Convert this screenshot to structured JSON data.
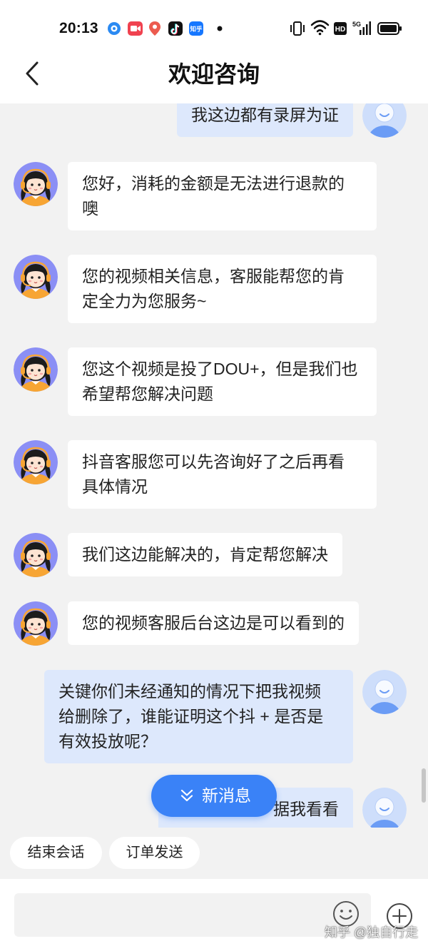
{
  "status_bar": {
    "time": "20:13",
    "notification_icons": [
      "app-circle-icon",
      "video-recorder-icon",
      "map-pin-icon",
      "tiktok-icon",
      "zhihu-icon",
      "more-dot-icon"
    ],
    "zhihu_icon_label": "知乎",
    "system_icons": [
      "vibrate-icon",
      "wifi-icon",
      "hd-icon",
      "signal-icon",
      "battery-icon"
    ],
    "hd_label": "HD",
    "network_label": "5G"
  },
  "header": {
    "back_icon": "chevron-left-icon",
    "title": "欢迎咨询"
  },
  "messages": [
    {
      "avatar_icon": "user-avatar-icon",
      "lines": [
        "我这边都有录屏为证"
      ]
    },
    {
      "avatar_icon": "agent-avatar-icon",
      "lines": [
        "您好，消耗的金额是无法进行退款的",
        "噢"
      ]
    },
    {
      "avatar_icon": "agent-avatar-icon",
      "lines": [
        "您的视频相关信息，客服能帮您的肯",
        "定全力为您服务~"
      ]
    },
    {
      "avatar_icon": "agent-avatar-icon",
      "lines": [
        "您这个视频是投了DOU+，但是我们也",
        "希望帮您解决问题"
      ]
    },
    {
      "avatar_icon": "agent-avatar-icon",
      "lines": [
        "抖音客服您可以先咨询好了之后再看",
        "具体情况"
      ]
    },
    {
      "avatar_icon": "agent-avatar-icon",
      "lines": [
        "我们这边能解决的，肯定帮您解决"
      ]
    },
    {
      "avatar_icon": "agent-avatar-icon",
      "lines": [
        "您的视频客服后台这边是可以看到的"
      ]
    },
    {
      "avatar_icon": "user-avatar-icon",
      "lines": [
        "关键你们未经通知的情况下把我视频",
        "给删除了，谁能证明这个抖 + 是否是",
        "有效投放呢？"
      ]
    },
    {
      "avatar_icon": "user-avatar-icon",
      "lines": [
        "据我看看"
      ]
    }
  ],
  "new_message_button": {
    "icon": "double-chevron-down-icon",
    "label": "新消息"
  },
  "quick_replies": [
    {
      "label": "结束会话"
    },
    {
      "label": "订单发送"
    }
  ],
  "composer": {
    "value": "",
    "emoji_icon": "smiley-icon",
    "add_icon": "plus-circle-icon"
  },
  "watermark": "知乎 @独自行走",
  "colors": {
    "chat_background": "#f2f2f2",
    "agent_bubble": "#ffffff",
    "user_bubble": "#dde8fc",
    "accent": "#3a82f7",
    "text": "#222222"
  }
}
